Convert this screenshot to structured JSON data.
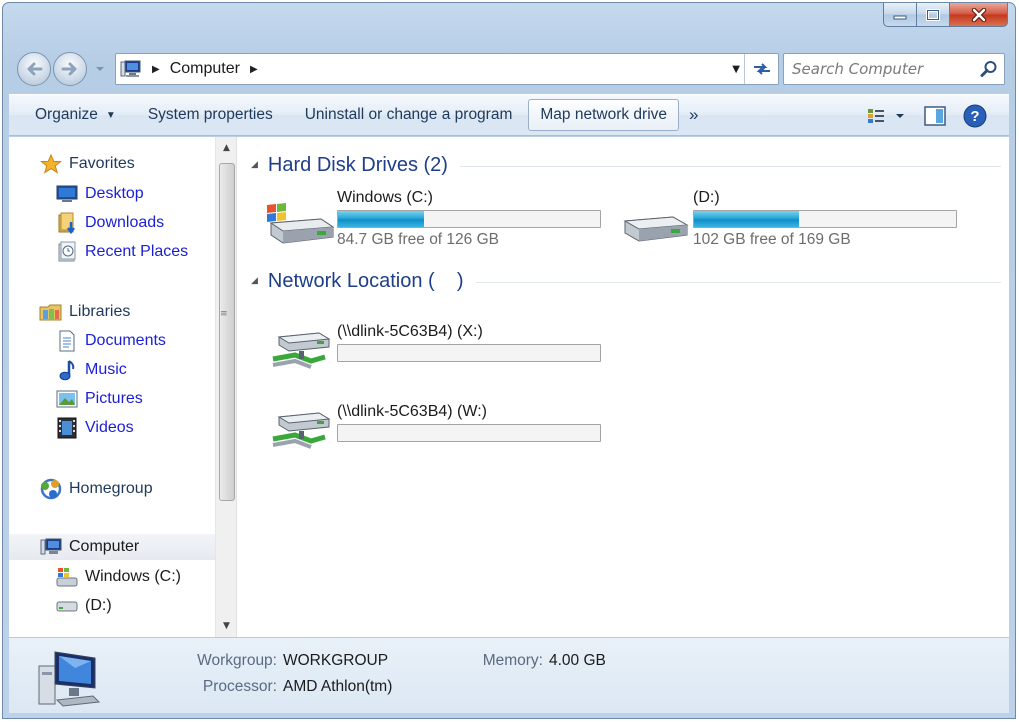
{
  "window": {
    "caption_buttons": [
      "minimize-icon",
      "maximize-icon",
      "close-icon"
    ]
  },
  "address": {
    "location": "Computer",
    "search_placeholder": "Search Computer"
  },
  "toolbar": {
    "organize": "Organize",
    "system_properties": "System properties",
    "uninstall": "Uninstall or change a program",
    "map_network_drive": "Map network drive",
    "more": "»"
  },
  "nav": {
    "favorites": {
      "label": "Favorites",
      "items": [
        {
          "label": "Desktop",
          "icon": "desktop-icon"
        },
        {
          "label": "Downloads",
          "icon": "downloads-icon"
        },
        {
          "label": "Recent Places",
          "icon": "recent-places-icon"
        }
      ]
    },
    "libraries": {
      "label": "Libraries",
      "items": [
        {
          "label": "Documents",
          "icon": "documents-icon"
        },
        {
          "label": "Music",
          "icon": "music-icon"
        },
        {
          "label": "Pictures",
          "icon": "pictures-icon"
        },
        {
          "label": "Videos",
          "icon": "videos-icon"
        }
      ]
    },
    "homegroup": {
      "label": "Homegroup"
    },
    "computer": {
      "label": "Computer",
      "items": [
        {
          "label": "Windows (C:)",
          "icon": "windows-drive-icon"
        },
        {
          "label": "(D:)",
          "icon": "drive-icon"
        }
      ]
    }
  },
  "main": {
    "hard_disk_section": "Hard Disk Drives (2)",
    "network_section": "Network Location (    )",
    "drives": [
      {
        "name": "Windows (C:)",
        "free": "84.7 GB free of 126 GB",
        "used_fraction": 0.33
      },
      {
        "name": "(D:)",
        "free": "102 GB free of 169 GB",
        "used_fraction": 0.4
      }
    ],
    "network_drives": [
      {
        "name": "(\\\\dlink-5C63B4) (X:)",
        "used_fraction": 0.0
      },
      {
        "name": "(\\\\dlink-5C63B4) (W:)",
        "used_fraction": 0.0
      }
    ]
  },
  "details": {
    "workgroup_label": "Workgroup:",
    "workgroup_value": "WORKGROUP",
    "memory_label": "Memory:",
    "memory_value": "4.00 GB",
    "processor_label": "Processor:",
    "processor_value": "AMD Athlon(tm)"
  },
  "colors": {
    "link_blue": "#1a1fd6",
    "section_blue": "#1e3e8a",
    "bar_fill": "#27a7d8"
  }
}
